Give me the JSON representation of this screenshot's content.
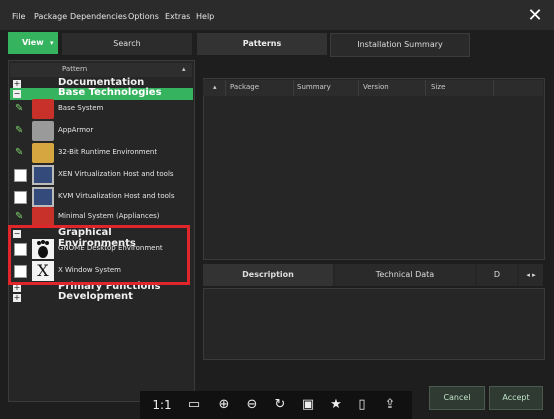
{
  "menu": {
    "items": [
      {
        "label": "File"
      },
      {
        "label": "Package"
      },
      {
        "label": "Dependencies"
      },
      {
        "label": "Options"
      },
      {
        "label": "Extras"
      },
      {
        "label": "Help"
      }
    ],
    "close_icon": "close-icon"
  },
  "top_tabs": {
    "view_label": "View",
    "search_label": "Search",
    "patterns_label": "Patterns",
    "installation_label": "Installation Summary"
  },
  "pattern_list": {
    "header_label": "Pattern",
    "categories": [
      {
        "title": "Documentation"
      },
      {
        "title": "Base Technologies"
      },
      {
        "title": "Graphical Environments"
      },
      {
        "title": "Primary Functions"
      },
      {
        "title": "Development"
      }
    ],
    "items": [
      {
        "label": "Base System"
      },
      {
        "label": "AppArmor"
      },
      {
        "label": "32-Bit Runtime Environment"
      },
      {
        "label": "XEN Virtualization Host and tools"
      },
      {
        "label": "KVM Virtualization Host and tools"
      },
      {
        "label": "Minimal System (Appliances)"
      },
      {
        "label": "GNOME Desktop Environment"
      },
      {
        "label": "X Window System"
      }
    ]
  },
  "package_table": {
    "columns": [
      "Package",
      "Summary",
      "Version",
      "Size"
    ]
  },
  "detail_tabs": {
    "description_label": "Description",
    "technical_label": "Technical Data",
    "dependencies_label": "D",
    "arrows_label": "◂ ▸"
  },
  "buttons": {
    "cancel_label": "Cancel",
    "accept_label": "Accept"
  },
  "viewer": {
    "zoom_label": "1:1"
  },
  "colors": {
    "accent_green": "#35b35f",
    "highlight_red": "#e0262a"
  }
}
